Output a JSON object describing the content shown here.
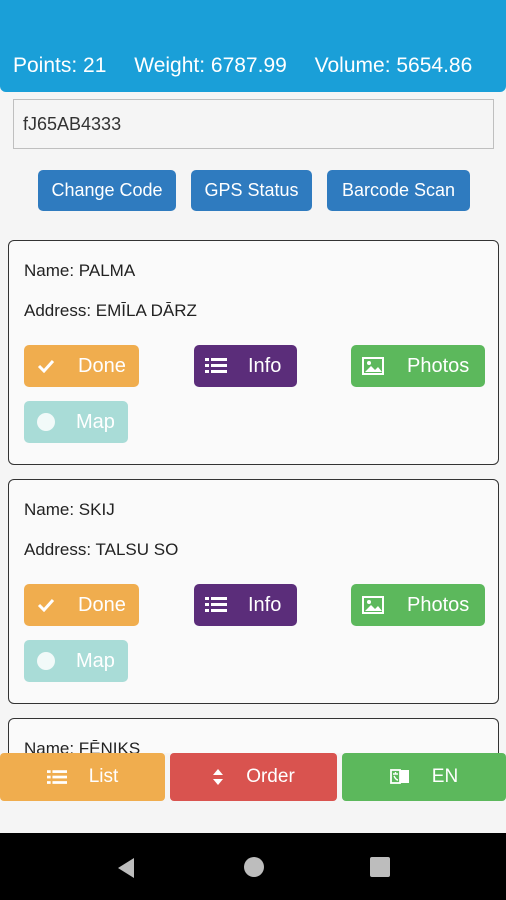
{
  "header": {
    "points": "Points: 21",
    "weight": "Weight: 6787.99",
    "volume": "Volume: 5654.86"
  },
  "code_input": {
    "value": "fJ65AB4333"
  },
  "toolbar": {
    "change_code": "Change Code",
    "gps_status": "GPS Status",
    "barcode_scan": "Barcode Scan"
  },
  "cards": [
    {
      "name": "Name: PALMA",
      "address": "Address: EMĪLA DĀRZ"
    },
    {
      "name": "Name: SKIJ",
      "address": "Address: TALSU SO"
    },
    {
      "name": "Name: FĒNIKS"
    }
  ],
  "actions": {
    "done": "Done",
    "info": "Info",
    "photos": "Photos",
    "map": "Map"
  },
  "bottom": {
    "list": "List",
    "order": "Order",
    "lang": "EN"
  },
  "colors": {
    "header": "#1a9fd8",
    "toolbar_button": "#2f7bbf",
    "done": "#f0ad4e",
    "info": "#5b2d7a",
    "photos": "#5cb85c",
    "map": "#a9dcd7",
    "order": "#d9534f"
  }
}
